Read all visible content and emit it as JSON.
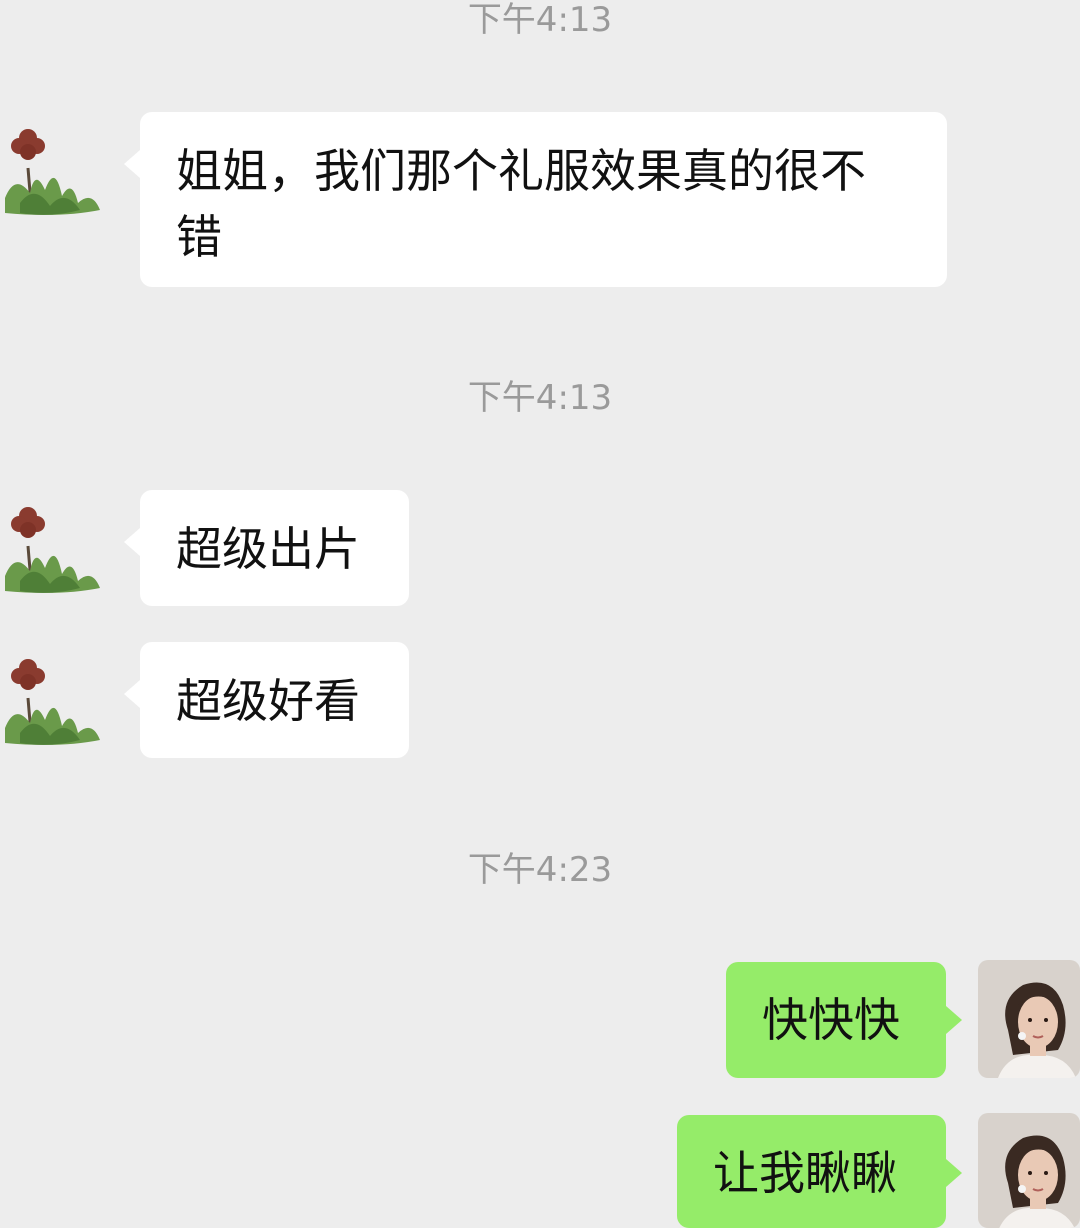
{
  "chat": {
    "timestamps": [
      "下午4:13",
      "下午4:13",
      "下午4:23"
    ],
    "messages": [
      {
        "sender": "contact",
        "text": "姐姐，我们那个礼服效果真的很不错",
        "avatar_icon": "flower-plant-icon"
      },
      {
        "sender": "contact",
        "text": "超级出片",
        "avatar_icon": "flower-plant-icon"
      },
      {
        "sender": "contact",
        "text": "超级好看",
        "avatar_icon": "flower-plant-icon"
      },
      {
        "sender": "me",
        "text": "快快快",
        "avatar_icon": "woman-portrait-icon"
      },
      {
        "sender": "me",
        "text": "让我瞅瞅",
        "avatar_icon": "woman-portrait-icon"
      }
    ]
  },
  "colors": {
    "background": "#ededed",
    "incoming_bubble": "#ffffff",
    "outgoing_bubble": "#95ec69",
    "timestamp_text": "#9a9a9a"
  }
}
